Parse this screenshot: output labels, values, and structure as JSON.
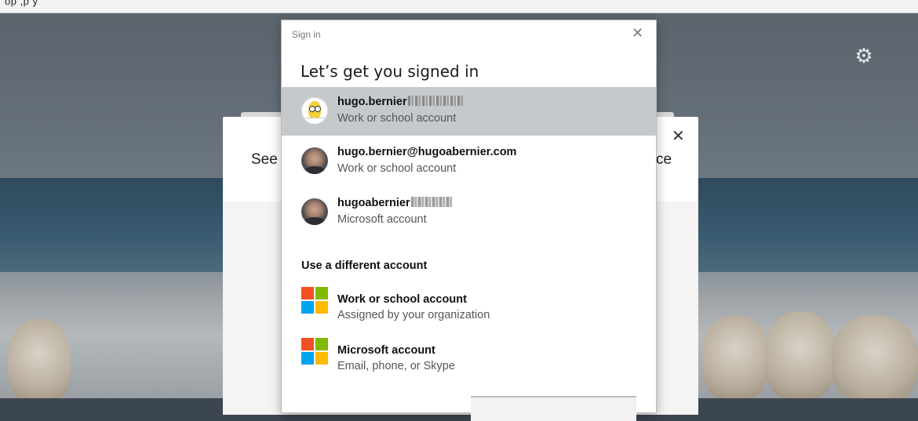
{
  "browser": {
    "partial_text": "op    ,p  y",
    "partial_link": "               "
  },
  "background_dialog": {
    "left_text": "See y",
    "right_text": "ce"
  },
  "dialog": {
    "title": "Sign in",
    "heading": "Let’s get you signed in",
    "accounts": [
      {
        "name": "hugo.bernier",
        "type": "Work or school account",
        "avatar": "homer-avatar",
        "selected": true
      },
      {
        "name": "hugo.bernier@hugoabernier.com",
        "type": "Work or school account",
        "avatar": "person-avatar",
        "selected": false
      },
      {
        "name": "hugoabernier",
        "type": "Microsoft account",
        "avatar": "person-avatar",
        "selected": false
      }
    ],
    "different_heading": "Use a different account",
    "options": [
      {
        "title": "Work or school account",
        "subtitle": "Assigned by your organization",
        "icon": "microsoft-logo-icon"
      },
      {
        "title": "Microsoft account",
        "subtitle": "Email, phone, or Skype",
        "icon": "microsoft-logo-icon"
      }
    ]
  },
  "colors": {
    "selected_row": "#c6c9cc",
    "ms_red": "#f25022",
    "ms_green": "#7fba00",
    "ms_blue": "#00a4ef",
    "ms_yellow": "#ffb900"
  }
}
